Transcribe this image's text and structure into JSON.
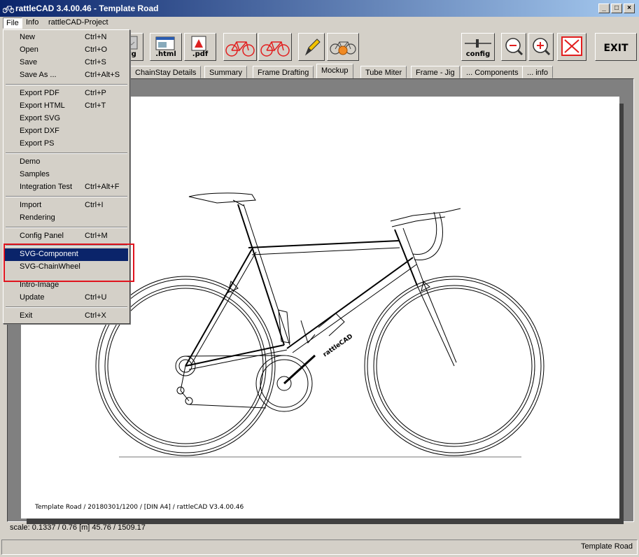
{
  "window": {
    "title": "rattleCAD  3.4.00.46 - Template Road",
    "minimize": "_",
    "maximize": "□",
    "close": "×"
  },
  "menubar": {
    "file": "File",
    "info": "Info",
    "project": "rattleCAD-Project"
  },
  "toolbar": {
    "svg_label": "svg",
    "html_label": ".html",
    "pdf_label": ".pdf",
    "config_label": "config",
    "exit_label": "EXIT"
  },
  "tabs": [
    "ChainStay Details",
    "Summary",
    "Frame Drafting",
    "Mockup",
    "Tube Miter",
    "Frame - Jig",
    "... Components",
    "... info"
  ],
  "active_tab": "Mockup",
  "file_menu": {
    "new": {
      "label": "New",
      "shortcut": "Ctrl+N"
    },
    "open": {
      "label": "Open",
      "shortcut": "Ctrl+O"
    },
    "save": {
      "label": "Save",
      "shortcut": "Ctrl+S"
    },
    "save_as": {
      "label": "Save As ...",
      "shortcut": "Ctrl+Alt+S"
    },
    "export_pdf": {
      "label": "Export PDF",
      "shortcut": "Ctrl+P"
    },
    "export_html": {
      "label": "Export HTML",
      "shortcut": "Ctrl+T"
    },
    "export_svg": {
      "label": "Export SVG",
      "shortcut": ""
    },
    "export_dxf": {
      "label": "Export DXF",
      "shortcut": ""
    },
    "export_ps": {
      "label": "Export PS",
      "shortcut": ""
    },
    "demo": {
      "label": "Demo",
      "shortcut": ""
    },
    "samples": {
      "label": "Samples",
      "shortcut": ""
    },
    "integration_test": {
      "label": "Integration Test",
      "shortcut": "Ctrl+Alt+F"
    },
    "import": {
      "label": "Import",
      "shortcut": "Ctrl+I"
    },
    "rendering": {
      "label": "Rendering",
      "shortcut": ""
    },
    "config_panel": {
      "label": "Config Panel",
      "shortcut": "Ctrl+M"
    },
    "svg_component": {
      "label": "SVG-Component",
      "shortcut": ""
    },
    "svg_chainwheel": {
      "label": "SVG-ChainWheel",
      "shortcut": ""
    },
    "intro_image": {
      "label": "Intro-Image",
      "shortcut": ""
    },
    "update": {
      "label": "Update",
      "shortcut": "Ctrl+U"
    },
    "exit": {
      "label": "Exit",
      "shortcut": "Ctrl+X"
    }
  },
  "highlighted_item": "SVG-Component",
  "drawing": {
    "footer": "Template Road   /   20180301/1200   /   [DIN A4]   /   rattleCAD   V3.4.00.46",
    "down_tube_text": "rattleCAD"
  },
  "status": {
    "scale_line": "scale: 0.1337 / 0.76  [m]  45.76 / 1509.17",
    "right_text": "Template Road"
  },
  "colors": {
    "title_blue": "#0a246a",
    "menu_highlight": "#0a246a",
    "callout_red": "#e0141e",
    "frame_red": "#e21e1e",
    "warm_orange": "#f08a24"
  },
  "icons": [
    "window-icon",
    "svg-export-icon",
    "html-export-icon",
    "pdf-export-icon",
    "bike-red-icon",
    "bike-red-2-icon",
    "pencil-icon",
    "bike-render-icon",
    "config-slider-icon",
    "zoom-out-icon",
    "zoom-in-icon",
    "fit-view-icon"
  ]
}
